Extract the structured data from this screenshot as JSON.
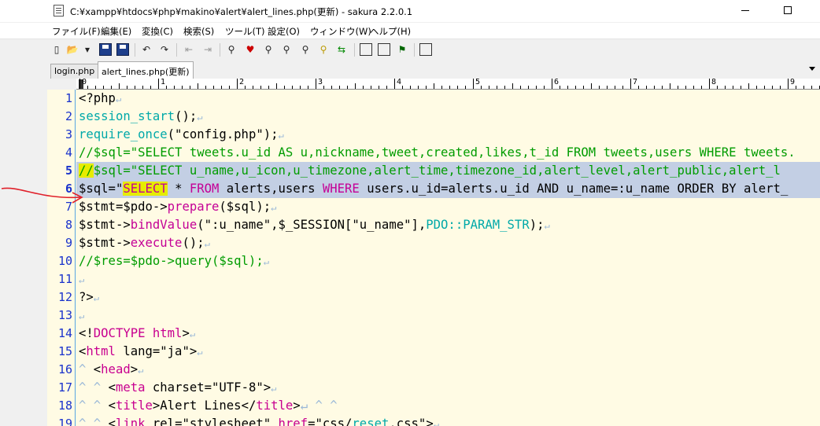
{
  "window": {
    "title": "C:¥xampp¥htdocs¥php¥makino¥alert¥alert_lines.php(更新) - sakura 2.2.0.1"
  },
  "menu": [
    "ファイル(F)",
    "編集(E)",
    "変換(C)",
    "検索(S)",
    "ツール(T)",
    "設定(O)",
    "ウィンドウ(W)",
    "ヘルプ(H)"
  ],
  "tabs": [
    {
      "label": "login.php",
      "active": false
    },
    {
      "label": "alert_lines.php(更新)",
      "active": true
    }
  ],
  "ruler": {
    "marks": [
      "0",
      "1",
      "2",
      "3",
      "4",
      "5",
      "6",
      "7",
      "8",
      "9"
    ]
  },
  "colors": {
    "editor_bg": "#fffbe4",
    "selection": "#c3cfe4",
    "line_numbers": "#1a33cc",
    "keyword": "#00a9a9",
    "comment": "#009c00",
    "highlight_marker": "#e6ec00",
    "annotation_arrow": "#e0202a"
  },
  "editor": {
    "lines": [
      {
        "n": "1",
        "segments": [
          {
            "t": "<?php",
            "c": ""
          }
        ],
        "eol": "↵"
      },
      {
        "n": "2",
        "segments": [
          {
            "t": "session_start",
            "c": "c-kw"
          },
          {
            "t": "();",
            "c": ""
          }
        ],
        "eol": "↵"
      },
      {
        "n": "3",
        "segments": [
          {
            "t": "require_once",
            "c": "c-kw"
          },
          {
            "t": "(\"config.php\");",
            "c": ""
          }
        ],
        "eol": "↵"
      },
      {
        "n": "4",
        "segments": [
          {
            "t": "//$sql=\"SELECT tweets.u_id AS u,nickname,tweet,created,likes,t_id FROM tweets,users WHERE tweets.",
            "c": "c-cmt"
          }
        ],
        "eol": ""
      },
      {
        "n": "5",
        "segments": [
          {
            "t": "//$sql=\"SELECT u_name,u_icon,u_timezone,alert_time,timezone_id,alert_level,alert_public,alert_l",
            "c": "c-cmt"
          }
        ],
        "eol": "",
        "selected": true,
        "bold": true
      },
      {
        "n": "6",
        "segments": [
          {
            "t": "$sql=\"",
            "c": ""
          },
          {
            "t": "SELECT",
            "c": "c-fn"
          },
          {
            "t": " * ",
            "c": ""
          },
          {
            "t": "FROM",
            "c": "c-fn"
          },
          {
            "t": " alerts,users ",
            "c": ""
          },
          {
            "t": "WHERE",
            "c": "c-fn"
          },
          {
            "t": " users.u_id=alerts.u_id AND u_name=:u_name ORDER BY alert_",
            "c": ""
          }
        ],
        "eol": "",
        "selected": true,
        "bold": true
      },
      {
        "n": "7",
        "segments": [
          {
            "t": "$stmt=$pdo->",
            "c": ""
          },
          {
            "t": "prepare",
            "c": "c-fn"
          },
          {
            "t": "($sql);",
            "c": ""
          }
        ],
        "eol": "↵"
      },
      {
        "n": "8",
        "segments": [
          {
            "t": "$stmt->",
            "c": ""
          },
          {
            "t": "bindValue",
            "c": "c-fn"
          },
          {
            "t": "(\":u_name\",$_SESSION[\"u_name\"],",
            "c": ""
          },
          {
            "t": "PDO::PARAM_STR",
            "c": "c-kw"
          },
          {
            "t": ");",
            "c": ""
          }
        ],
        "eol": "↵"
      },
      {
        "n": "9",
        "segments": [
          {
            "t": "$stmt->",
            "c": ""
          },
          {
            "t": "execute",
            "c": "c-fn"
          },
          {
            "t": "();",
            "c": ""
          }
        ],
        "eol": "↵"
      },
      {
        "n": "10",
        "segments": [
          {
            "t": "//$res=$pdo->query($sql);",
            "c": "c-cmt"
          }
        ],
        "eol": "↵"
      },
      {
        "n": "11",
        "segments": [],
        "eol": "↵"
      },
      {
        "n": "12",
        "segments": [
          {
            "t": "?>",
            "c": ""
          }
        ],
        "eol": "↵"
      },
      {
        "n": "13",
        "segments": [],
        "eol": "↵"
      },
      {
        "n": "14",
        "segments": [
          {
            "t": "<!",
            "c": ""
          },
          {
            "t": "DOCTYPE",
            "c": "c-tag"
          },
          {
            "t": " ",
            "c": ""
          },
          {
            "t": "html",
            "c": "c-tag"
          },
          {
            "t": ">",
            "c": ""
          }
        ],
        "eol": "↵"
      },
      {
        "n": "15",
        "segments": [
          {
            "t": "<",
            "c": ""
          },
          {
            "t": "html",
            "c": "c-tag"
          },
          {
            "t": " lang=\"ja\">",
            "c": ""
          }
        ],
        "eol": "↵"
      },
      {
        "n": "16",
        "segments": [
          {
            "t": "^ ",
            "c": "c-tab"
          },
          {
            "t": "<",
            "c": ""
          },
          {
            "t": "head",
            "c": "c-tag"
          },
          {
            "t": ">",
            "c": ""
          }
        ],
        "eol": "↵"
      },
      {
        "n": "17",
        "segments": [
          {
            "t": "^ ^ ",
            "c": "c-tab"
          },
          {
            "t": "<",
            "c": ""
          },
          {
            "t": "meta",
            "c": "c-tag"
          },
          {
            "t": " charset=\"UTF-8\">",
            "c": ""
          }
        ],
        "eol": "↵"
      },
      {
        "n": "18",
        "segments": [
          {
            "t": "^ ^ ",
            "c": "c-tab"
          },
          {
            "t": "<",
            "c": ""
          },
          {
            "t": "title",
            "c": "c-tag"
          },
          {
            "t": ">Alert Lines</",
            "c": ""
          },
          {
            "t": "title",
            "c": "c-tag"
          },
          {
            "t": ">",
            "c": ""
          },
          {
            "t": "↵ ^ ^",
            "c": "c-tab"
          }
        ],
        "eol": ""
      },
      {
        "n": "19",
        "segments": [
          {
            "t": "^ ^ ",
            "c": "c-tab"
          },
          {
            "t": "<",
            "c": ""
          },
          {
            "t": "link",
            "c": "c-tag"
          },
          {
            "t": " rel=\"stylesheet\" ",
            "c": ""
          },
          {
            "t": "href",
            "c": "c-tag"
          },
          {
            "t": "=\"css/",
            "c": ""
          },
          {
            "t": "reset",
            "c": "c-kw"
          },
          {
            "t": ".css\">",
            "c": ""
          }
        ],
        "eol": "↵"
      }
    ]
  }
}
